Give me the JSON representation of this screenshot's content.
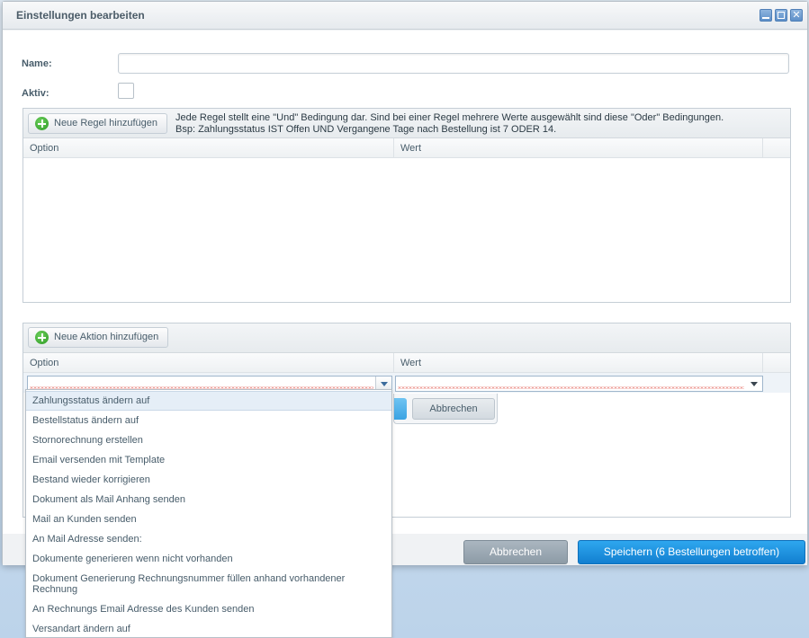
{
  "window": {
    "title": "Einstellungen bearbeiten",
    "buttons": [
      "minimize",
      "maximize",
      "close"
    ]
  },
  "form": {
    "name_label": "Name:",
    "name_value": "",
    "aktiv_label": "Aktiv:",
    "aktiv_checked": false
  },
  "rules": {
    "add_button": "Neue Regel hinzufügen",
    "hint_line1": "Jede Regel stellt eine \"Und\" Bedingung dar. Sind bei einer Regel mehrere Werte ausgewählt sind diese \"Oder\" Bedingungen.",
    "hint_line2": "Bsp: Zahlungsstatus IST Offen UND Vergangene Tage nach Bestellung ist 7 ODER 14.",
    "columns": [
      "Option",
      "Wert"
    ]
  },
  "actions": {
    "add_button": "Neue Aktion hinzufügen",
    "columns": [
      "Option",
      "Wert"
    ],
    "editor_cancel": "Abbrechen"
  },
  "dropdown": {
    "selected_index": 0,
    "items": [
      "Zahlungsstatus ändern auf",
      "Bestellstatus ändern auf",
      "Stornorechnung erstellen",
      "Email versenden mit Template",
      "Bestand wieder korrigieren",
      "Dokument als Mail Anhang senden",
      "Mail an Kunden senden",
      "An Mail Adresse senden:",
      "Dokumente generieren wenn nicht vorhanden",
      "Dokument Generierung Rechnungsnummer füllen anhand vorhandener Rechnung",
      "An Rechnungs Email Adresse des Kunden senden",
      "Versandart ändern auf"
    ]
  },
  "footer": {
    "cancel": "Abbrechen",
    "save": "Speichern (6 Bestellungen betroffen)"
  },
  "colors": {
    "accent": "#1c8fe0",
    "add_icon": "#3aa52f",
    "error_underline": "#e04a3f"
  }
}
